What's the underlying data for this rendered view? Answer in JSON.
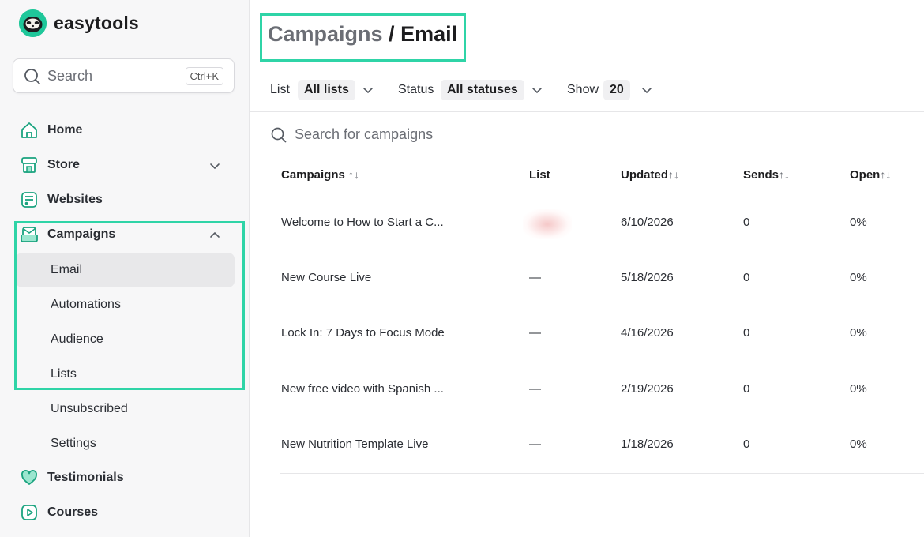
{
  "app": {
    "name": "easytools"
  },
  "sidebar": {
    "search": {
      "placeholder": "Search",
      "shortcut": "Ctrl+K"
    },
    "items": [
      {
        "label": "Home",
        "icon": "home-icon"
      },
      {
        "label": "Store",
        "icon": "store-icon",
        "expandable": true
      },
      {
        "label": "Websites",
        "icon": "websites-icon"
      },
      {
        "label": "Campaigns",
        "icon": "campaigns-icon",
        "expanded": true
      },
      {
        "label": "Testimonials",
        "icon": "heart-icon"
      },
      {
        "label": "Courses",
        "icon": "courses-icon"
      }
    ],
    "campaign_sub": [
      "Email",
      "Automations",
      "Audience",
      "Lists",
      "Unsubscribed",
      "Settings"
    ],
    "active_sub": "Email"
  },
  "breadcrumb": {
    "parent": "Campaigns",
    "separator": " / ",
    "current": "Email"
  },
  "filters": {
    "list_label": "List",
    "list_value": "All lists",
    "status_label": "Status",
    "status_value": "All statuses",
    "show_label": "Show",
    "show_value": "20"
  },
  "table": {
    "search_placeholder": "Search for campaigns",
    "columns": [
      "Campaigns",
      "List",
      "Updated",
      "Sends",
      "Open"
    ],
    "sort_glyph": "↑↓",
    "rows": [
      {
        "name": "Welcome to How to Start a C...",
        "list": "",
        "updated": "6/10/2026",
        "sends": "0",
        "open": "0%"
      },
      {
        "name": "New Course Live",
        "list": "—",
        "updated": "5/18/2026",
        "sends": "0",
        "open": "0%"
      },
      {
        "name": "Lock In: 7 Days to Focus Mode",
        "list": "—",
        "updated": "4/16/2026",
        "sends": "0",
        "open": "0%"
      },
      {
        "name": "New free video with Spanish ...",
        "list": "—",
        "updated": "2/19/2026",
        "sends": "0",
        "open": "0%"
      },
      {
        "name": "New Nutrition Template Live",
        "list": "—",
        "updated": "1/18/2026",
        "sends": "0",
        "open": "0%"
      }
    ]
  },
  "colors": {
    "accent": "#20c997",
    "highlight": "#2fd4a7"
  }
}
